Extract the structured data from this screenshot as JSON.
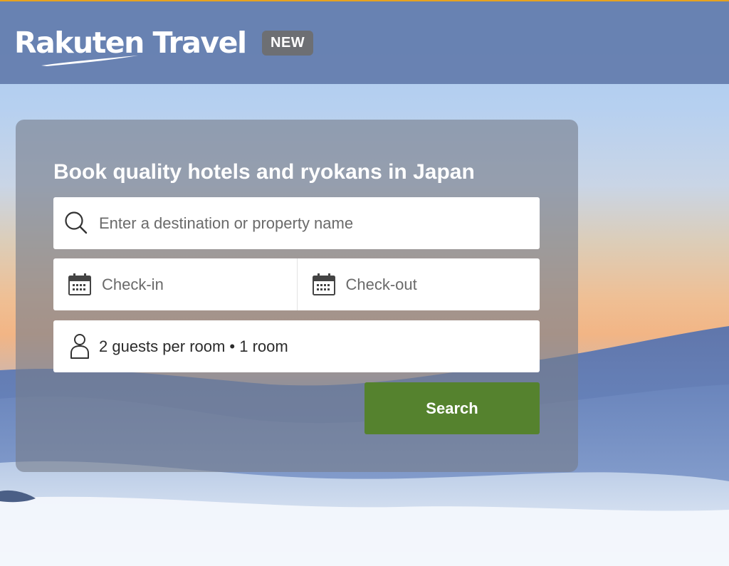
{
  "header": {
    "logo_text": "Rakuten Travel",
    "badge": "NEW"
  },
  "search_panel": {
    "title": "Book quality hotels and ryokans in Japan",
    "destination": {
      "placeholder": "Enter a destination or property name",
      "value": "",
      "icon": "search-icon"
    },
    "check_in": {
      "label": "Check-in",
      "icon": "calendar-icon"
    },
    "check_out": {
      "label": "Check-out",
      "icon": "calendar-icon"
    },
    "guests": {
      "label": "2 guests per room • 1 room",
      "icon": "person-icon"
    },
    "search_button": "Search"
  },
  "colors": {
    "header_accent_border": "#e6a21f",
    "header_bg": "#5e78a8",
    "badge_bg": "#6d6f73",
    "search_button_bg": "#55822e",
    "panel_bg": "#767c8a"
  }
}
